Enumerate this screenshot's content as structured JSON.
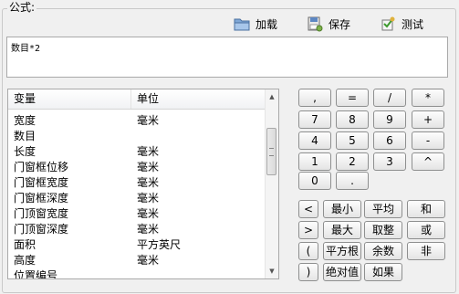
{
  "formula_group": {
    "title": "公式:"
  },
  "toolbar": {
    "load": {
      "label": "加载",
      "icon": "folder-icon"
    },
    "save": {
      "label": "保存",
      "icon": "save-icon"
    },
    "test": {
      "label": "测试",
      "icon": "test-icon"
    }
  },
  "formula": {
    "value": "数目*2"
  },
  "variables": {
    "columns": [
      "变量",
      "单位"
    ],
    "rows": [
      [
        "宽度",
        "毫米"
      ],
      [
        "数目",
        ""
      ],
      [
        "长度",
        "毫米"
      ],
      [
        "门窗框位移",
        "毫米"
      ],
      [
        "门窗框宽度",
        "毫米"
      ],
      [
        "门窗框深度",
        "毫米"
      ],
      [
        "门顶窗宽度",
        "毫米"
      ],
      [
        "门顶窗深度",
        "毫米"
      ],
      [
        "面积",
        "平方英尺"
      ],
      [
        "高度",
        "毫米"
      ],
      [
        "位置编号",
        ""
      ]
    ]
  },
  "keypad": {
    "symbols": [
      ",",
      "=",
      "/",
      "*",
      "7",
      "8",
      "9",
      "+",
      "4",
      "5",
      "6",
      "-",
      "1",
      "2",
      "3",
      "^",
      "0",
      "."
    ],
    "functions": [
      "<",
      "最小",
      "平均",
      "和",
      ">",
      "最大",
      "取整",
      "或",
      "(",
      "平方根",
      "余数",
      "非",
      ")",
      "绝对值",
      "如果"
    ]
  },
  "colors": {
    "background": "#f0f0f0",
    "border": "#a9a9a9"
  }
}
